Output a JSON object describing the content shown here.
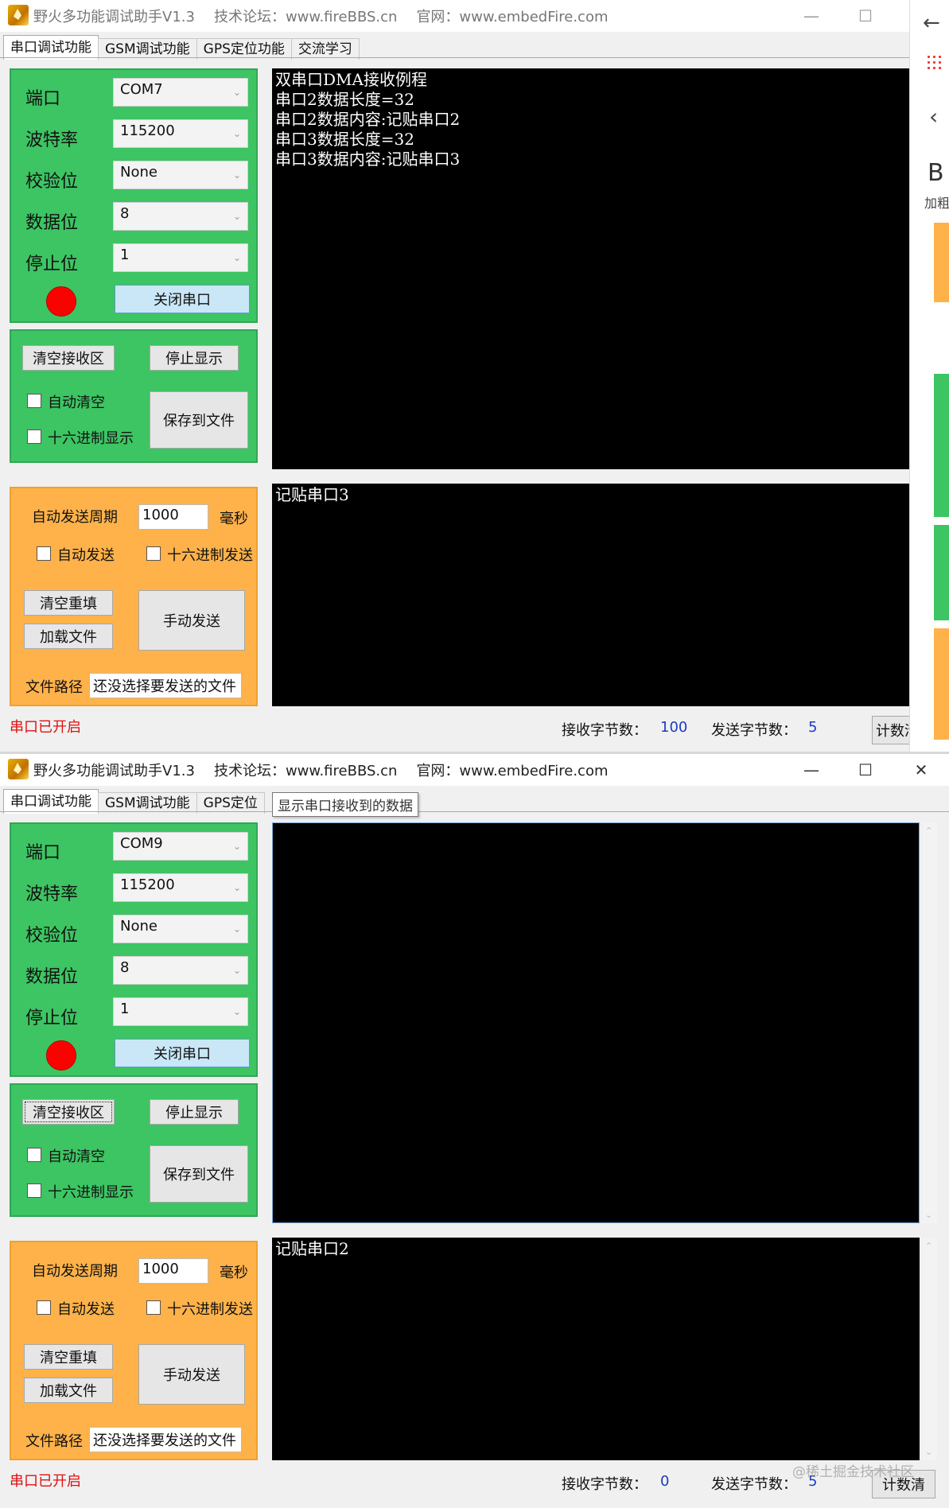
{
  "windows": [
    {
      "title_app": "野火多功能调试助手V1.3",
      "title_forum": "技术论坛：www.fireBBS.cn",
      "title_site": "官网：www.embedFire.com",
      "tabs": [
        "串口调试功能",
        "GSM调试功能",
        "GPS定位功能",
        "交流学习"
      ],
      "serial": {
        "port_label": "端口",
        "port_value": "COM7",
        "baud_label": "波特率",
        "baud_value": "115200",
        "parity_label": "校验位",
        "parity_value": "None",
        "databits_label": "数据位",
        "databits_value": "8",
        "stopbits_label": "停止位",
        "stopbits_value": "1",
        "close_btn": "关闭串口"
      },
      "receive": {
        "clear_btn": "清空接收区",
        "stop_btn": "停止显示",
        "auto_clear": "自动清空",
        "hex_display": "十六进制显示",
        "save_btn": "保存到文件"
      },
      "send": {
        "period_label": "自动发送周期",
        "period_value": "1000",
        "ms_label": "毫秒",
        "auto_send": "自动发送",
        "hex_send": "十六进制发送",
        "clear_btn": "清空重填",
        "load_btn": "加载文件",
        "manual_btn": "手动发送",
        "path_label": "文件路径",
        "path_value": "还没选择要发送的文件"
      },
      "rx_lines": [
        "双串口DMA接收例程",
        "串口2数据长度=32",
        "串口2数据内容:记贴串口2",
        "串口3数据长度=32",
        "串口3数据内容:记贴串口3"
      ],
      "tx_text": "记贴串口3",
      "status": "串口已开启",
      "rx_count_label": "接收字节数：",
      "rx_count": "100",
      "tx_count_label": "发送字节数：",
      "tx_count": "5",
      "count_btn": "计数清"
    },
    {
      "title_app": "野火多功能调试助手V1.3",
      "title_forum": "技术论坛：www.fireBBS.cn",
      "title_site": "官网：www.embedFire.com",
      "tabs": [
        "串口调试功能",
        "GSM调试功能",
        "GPS定位"
      ],
      "tooltip": "显示串口接收到的数据",
      "serial": {
        "port_label": "端口",
        "port_value": "COM9",
        "baud_label": "波特率",
        "baud_value": "115200",
        "parity_label": "校验位",
        "parity_value": "None",
        "databits_label": "数据位",
        "databits_value": "8",
        "stopbits_label": "停止位",
        "stopbits_value": "1",
        "close_btn": "关闭串口"
      },
      "receive": {
        "clear_btn": "清空接收区",
        "stop_btn": "停止显示",
        "auto_clear": "自动清空",
        "hex_display": "十六进制显示",
        "save_btn": "保存到文件"
      },
      "send": {
        "period_label": "自动发送周期",
        "period_value": "1000",
        "ms_label": "毫秒",
        "auto_send": "自动发送",
        "hex_send": "十六进制发送",
        "clear_btn": "清空重填",
        "load_btn": "加载文件",
        "manual_btn": "手动发送",
        "path_label": "文件路径",
        "path_value": "还没选择要发送的文件"
      },
      "tx_text": "记贴串口2",
      "status": "串口已开启",
      "rx_count_label": "接收字节数：",
      "rx_count": "0",
      "tx_count_label": "发送字节数：",
      "tx_count": "5",
      "count_btn": "计数清"
    }
  ],
  "side": {
    "b_label": "B",
    "bold_label": "加粗"
  },
  "watermark": "@稀土掘金技术社区",
  "colors": {
    "green": "#3dc463",
    "orange": "#ffb24a",
    "led": "#ff0000",
    "value_blue": "#1a3cc0",
    "status_red": "#e01010"
  }
}
